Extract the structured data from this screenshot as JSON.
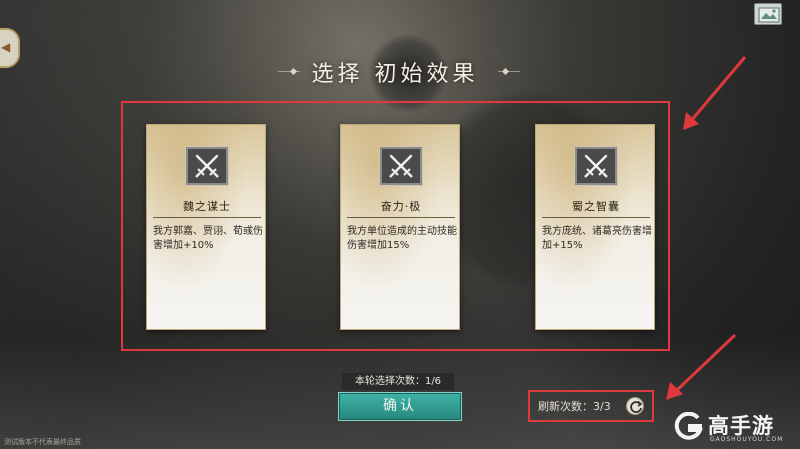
{
  "title": {
    "text": "选择 初始效果"
  },
  "cards": [
    {
      "name": "魏之谋士",
      "desc": "我方郭嘉、贾诩、荀彧伤害增加+10%",
      "icon": "crossed-swords-icon"
    },
    {
      "name": "奋力·极",
      "desc": "我方单位造成的主动技能伤害增加15%",
      "icon": "crossed-swords-icon"
    },
    {
      "name": "蜀之智囊",
      "desc": "我方庞统、诸葛亮伤害增加+15%",
      "icon": "crossed-swords-icon"
    }
  ],
  "round": {
    "label": "本轮选择次数：1/6"
  },
  "confirm": {
    "label": "确认"
  },
  "refresh": {
    "label": "刷新次数：3/3",
    "icon": "refresh-icon"
  },
  "watermark": {
    "brand": "高手游",
    "site": "GAOSHOUYOU.COM"
  },
  "disclaimer": {
    "text": "测试版本不代表最终品质"
  },
  "colors": {
    "highlight": "#e0393d",
    "confirm_button": "#2f9c90",
    "card_paper": "#ece4cf"
  }
}
